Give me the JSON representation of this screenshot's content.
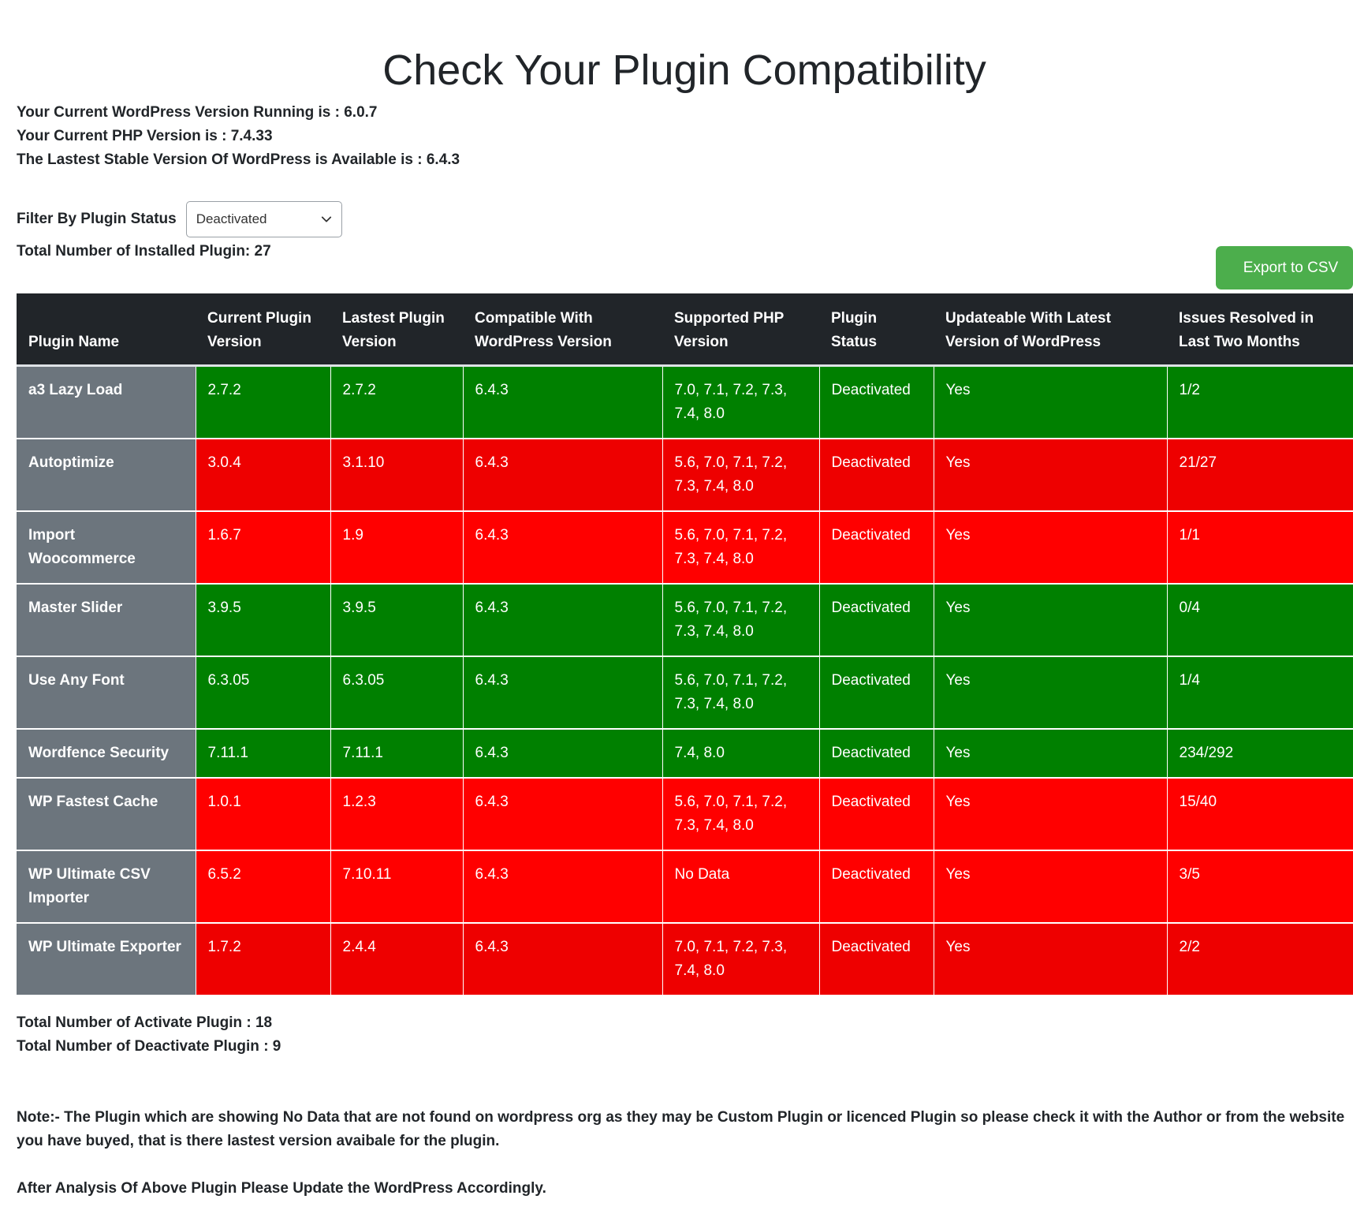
{
  "page": {
    "title": "Check Your Plugin Compatibility"
  },
  "info": {
    "wp_version_line": "Your Current WordPress Version Running is : 6.0.7",
    "php_version_line": "Your Current PHP Version is : 7.4.33",
    "latest_wp_line": "The Lastest Stable Version Of WordPress is Available is : 6.4.3"
  },
  "filter": {
    "label": "Filter By Plugin Status",
    "selected": "Deactivated",
    "chevron_icon": "chevron-down-icon"
  },
  "total_installed": "Total Number of Installed Plugin: 27",
  "export_button": "Export to CSV",
  "colors": {
    "compatible": "#008000",
    "incompatible": "#ff0000",
    "incompatible_alt": "#ee0000",
    "name_cell": "#6c757d",
    "header": "#212529",
    "export": "#4cae4c"
  },
  "table": {
    "headers": [
      "Plugin Name",
      "Current Plugin Version",
      "Lastest Plugin Version",
      "Compatible With WordPress Version",
      "Supported PHP Version",
      "Plugin Status",
      "Updateable With Latest Version of WordPress",
      "Issues Resolved in Last Two Months"
    ],
    "rows": [
      {
        "status_color": "green",
        "cells": [
          "a3 Lazy Load",
          "2.7.2",
          "2.7.2",
          "6.4.3",
          "7.0, 7.1, 7.2, 7.3, 7.4, 8.0",
          "Deactivated",
          "Yes",
          "1/2"
        ]
      },
      {
        "status_color": "red2",
        "cells": [
          "Autoptimize",
          "3.0.4",
          "3.1.10",
          "6.4.3",
          "5.6, 7.0, 7.1, 7.2, 7.3, 7.4, 8.0",
          "Deactivated",
          "Yes",
          "21/27"
        ]
      },
      {
        "status_color": "red",
        "cells": [
          "Import Woocommerce",
          "1.6.7",
          "1.9",
          "6.4.3",
          "5.6, 7.0, 7.1, 7.2, 7.3, 7.4, 8.0",
          "Deactivated",
          "Yes",
          "1/1"
        ]
      },
      {
        "status_color": "green",
        "cells": [
          "Master Slider",
          "3.9.5",
          "3.9.5",
          "6.4.3",
          "5.6, 7.0, 7.1, 7.2, 7.3, 7.4, 8.0",
          "Deactivated",
          "Yes",
          "0/4"
        ]
      },
      {
        "status_color": "green",
        "cells": [
          "Use Any Font",
          "6.3.05",
          "6.3.05",
          "6.4.3",
          "5.6, 7.0, 7.1, 7.2, 7.3, 7.4, 8.0",
          "Deactivated",
          "Yes",
          "1/4"
        ]
      },
      {
        "status_color": "green",
        "cells": [
          "Wordfence Security",
          "7.11.1",
          "7.11.1",
          "6.4.3",
          "7.4, 8.0",
          "Deactivated",
          "Yes",
          "234/292"
        ]
      },
      {
        "status_color": "red",
        "cells": [
          "WP Fastest Cache",
          "1.0.1",
          "1.2.3",
          "6.4.3",
          "5.6, 7.0, 7.1, 7.2, 7.3, 7.4, 8.0",
          "Deactivated",
          "Yes",
          "15/40"
        ]
      },
      {
        "status_color": "red",
        "cells": [
          "WP Ultimate CSV Importer",
          "6.5.2",
          "7.10.11",
          "6.4.3",
          "No Data",
          "Deactivated",
          "Yes",
          "3/5"
        ]
      },
      {
        "status_color": "red2",
        "cells": [
          "WP Ultimate Exporter",
          "1.7.2",
          "2.4.4",
          "6.4.3",
          "7.0, 7.1, 7.2, 7.3, 7.4, 8.0",
          "Deactivated",
          "Yes",
          "2/2"
        ]
      }
    ]
  },
  "footer": {
    "active_count": "Total Number of Activate Plugin : 18",
    "deactive_count": "Total Number of Deactivate Plugin : 9",
    "note": "Note:- The Plugin which are showing No Data that are not found on wordpress org as they may be Custom Plugin or licenced Plugin so please check it with the Author or from the website you have buyed, that is there lastest version avaibale for the plugin.",
    "final": "After Analysis Of Above Plugin Please Update the WordPress Accordingly."
  }
}
